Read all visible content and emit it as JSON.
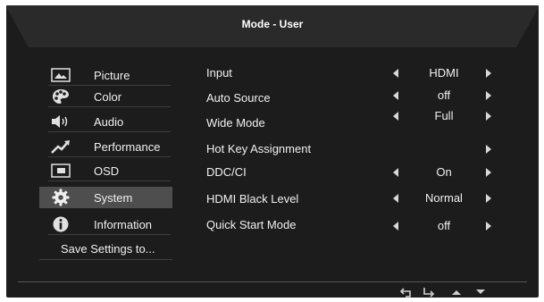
{
  "header": {
    "title": "Mode - User"
  },
  "sidebar": {
    "items": [
      {
        "label": "Picture",
        "icon": "picture-icon"
      },
      {
        "label": "Color",
        "icon": "palette-icon"
      },
      {
        "label": "Audio",
        "icon": "speaker-icon"
      },
      {
        "label": "Performance",
        "icon": "performance-icon"
      },
      {
        "label": "OSD",
        "icon": "osd-icon"
      },
      {
        "label": "System",
        "icon": "gear-icon",
        "selected": true
      },
      {
        "label": "Information",
        "icon": "info-icon"
      }
    ],
    "save_label": "Save Settings to..."
  },
  "settings": [
    {
      "label": "Input",
      "value": "HDMI",
      "left_arrow": true,
      "right_arrow": true
    },
    {
      "label": "Auto Source",
      "value": "off",
      "left_arrow": true,
      "right_arrow": true
    },
    {
      "label": "Wide Mode",
      "value": "Full",
      "left_arrow": true,
      "right_arrow": true
    },
    {
      "label": "Hot Key Assignment",
      "value": "",
      "left_arrow": false,
      "right_arrow": true
    },
    {
      "label": "DDC/CI",
      "value": "On",
      "left_arrow": true,
      "right_arrow": true
    },
    {
      "label": "HDMI Black Level",
      "value": "Normal",
      "left_arrow": true,
      "right_arrow": true
    },
    {
      "label": "Quick Start Mode",
      "value": "off",
      "left_arrow": true,
      "right_arrow": true
    }
  ],
  "footer": {
    "buttons": [
      "back-icon",
      "enter-icon",
      "up-icon",
      "down-icon"
    ]
  },
  "colors": {
    "background": "#1c1c1c",
    "selected": "#4e4e4e",
    "text": "#f0f0f0"
  }
}
